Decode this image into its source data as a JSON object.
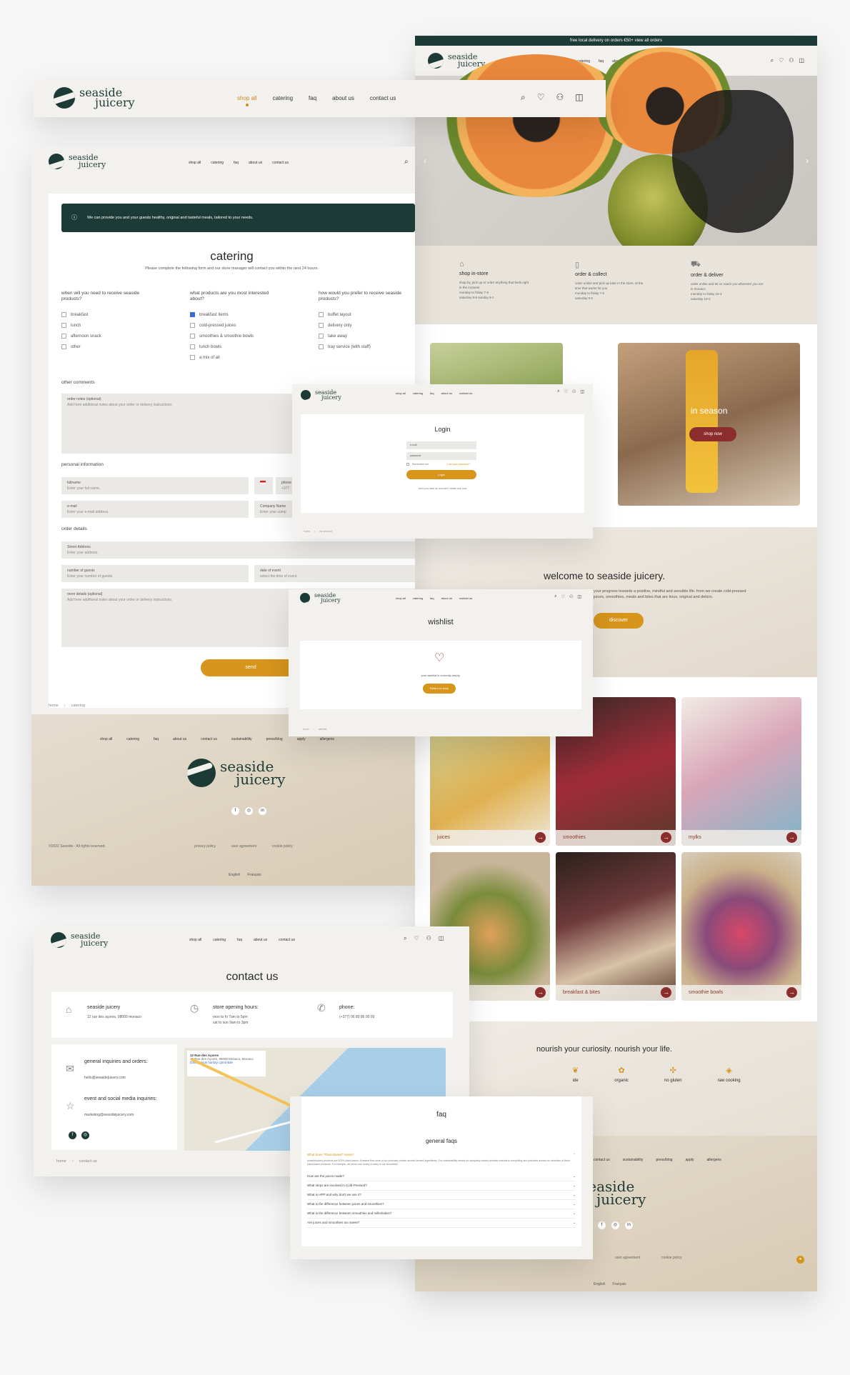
{
  "colors": {
    "brand_green": "#1d3b36",
    "accent_orange": "#d7951b",
    "berry": "#8c2d2d",
    "beige": "#e3d9c8"
  },
  "brand": {
    "line1": "seaside",
    "line2": "juicery"
  },
  "nav": {
    "shop": "shop all",
    "catering": "catering",
    "faq": "faq",
    "about": "about us",
    "contact": "contact us"
  },
  "icons": [
    "search-icon",
    "heart-icon",
    "user-icon",
    "bag-icon"
  ],
  "home": {
    "banner": "free local delivery on orders €50+ view all orders",
    "services": [
      {
        "title": "shop in-store",
        "lines": [
          "shop by, pick up or order anything that feels right",
          "in the moment",
          "monday to friday 7-5",
          "saturday 9-5 sunday 9-1"
        ]
      },
      {
        "title": "order & collect",
        "lines": [
          "order online and pick up later in the store, at the",
          "time that works for you",
          "monday to friday 7-5",
          "saturday 9-5"
        ]
      },
      {
        "title": "order & deliver",
        "lines": [
          "order online and let us reach you wherever you are",
          "in monaco",
          "monday to friday 10-3",
          "saturday 10-2"
        ]
      }
    ],
    "season_title": "in season",
    "season_btn": "shop now",
    "welcome_title": "welcome to seaside juicery.",
    "welcome_text": "your progress towards a positive, mindful and sensible life. from we create cold-pressed juices, smoothies, meals and bites that are tious, original and delicio.",
    "discover": "discover",
    "tiles": [
      "juices",
      "smoothies",
      "mylks",
      "",
      "breakfast & bites",
      "smoothie bowls"
    ],
    "nourish": "nourish your curiosity. nourish your life.",
    "values": [
      "ide",
      "organic",
      "no gluten",
      "raw cooking"
    ],
    "footer_links": [
      "contact us",
      "sustainability",
      "press/blog",
      "apply",
      "allergens"
    ],
    "legal": [
      "user agreement",
      "cookie policy"
    ],
    "langs": [
      "English",
      "Français"
    ]
  },
  "catering": {
    "notice": "We can provide you and your guests healthy, original and tasteful meals, tailored to your needs.",
    "title": "catering",
    "subtitle": "Please complete the following form and our store manager will contact you within the next 24 hours.",
    "q1": "when will you need to receive seaside products?",
    "q1_opts": [
      "breakfast",
      "lunch",
      "afternoon snack",
      "other"
    ],
    "q2": "what products are you most interested about?",
    "q2_opts": [
      "breakfast items",
      "cold-pressed juices",
      "smoothies & smoothie bowls",
      "lunch bowls",
      "a mix of all"
    ],
    "q3": "how would you prefer to receive seaside products?",
    "q3_opts": [
      "buffet layout",
      "delivery only",
      "take away",
      "tray service (with staff)"
    ],
    "other_comments": "other comments",
    "order_notes": "order notes (optional)",
    "order_notes_ph": "Add here additional notes about your order or delivery instructions.",
    "personal": "personal information",
    "fullname": "fullname",
    "fullname_ph": "Enter your full name.",
    "phone": "phone",
    "phone_ph": "+377",
    "email": "e-mail",
    "email_ph": "Enter your e-mail address.",
    "company": "Company Name",
    "company_ph": "Enter your comp",
    "order_details": "order details",
    "street": "Street Address",
    "street_ph": "Enter your address.",
    "guests": "number of guests",
    "guests_ph": "Enter your number of guests.",
    "date": "date of event",
    "date_ph": "select the time of event.",
    "more": "more details (optional)",
    "more_ph": "Add here additional notes about your order or delivery instructions.",
    "send": "send",
    "crumb_home": "home",
    "crumb_cur": "catering"
  },
  "footer": {
    "links": [
      "shop all",
      "catering",
      "faq",
      "about us",
      "contact us",
      "sustainability",
      "press/blog",
      "apply",
      "allergens"
    ],
    "copyright": "©2022 Seaside - All rights reserved.",
    "legal": [
      "privacy policy",
      "user agreement",
      "cookie policy"
    ],
    "langs": [
      "English",
      "Français"
    ]
  },
  "login": {
    "title": "Login",
    "email_ph": "e-mail",
    "pass_ph": "password",
    "remember": "Remember me",
    "forgot": "Lost your password?",
    "btn": "Login",
    "signup": "don't you have an account? create one now",
    "crumb_home": "home",
    "crumb_cur": "my account"
  },
  "wishlist": {
    "title": "wishlist",
    "empty": "your wishlist is currently empty.",
    "btn": "Return to shop",
    "crumb_home": "home",
    "crumb_cur": "wishlist"
  },
  "contact": {
    "title": "contact us",
    "store": "seaside juicery",
    "address": "12 rue des açores, 98000 monaco",
    "hours_title": "store opening hours:",
    "hours1": "mon to fri 7am to 5pm",
    "hours2": "sat to sun 9am to 3pm",
    "phone_title": "phone:",
    "phone": "(+377) 06 80 86 00 00",
    "gen_title": "general inquiries and orders:",
    "gen_email": "hello@seasidejuicery.com",
    "event_title": "event and social media inquiries:",
    "event_email": "marketing@seasidejuicery.com",
    "map_place": "12 Rue des Açores",
    "map_addr": "12 Rue des Açores, 98000 Monaco, Monaco",
    "map_link": "Daha büyük haritayı görüntüle",
    "crumb_home": "home",
    "crumb_cur": "contact us"
  },
  "faq": {
    "title": "faq",
    "section": "general faqs",
    "open_q": "What does \"Plant-Based\" mean?",
    "open_a": "seasidejuicery products are 100% plant-based. It means that none of our products contain animal-derived ingredients. Our sustainability means for sympathy toward animals extends to everything and practices across our selection of fresh plant-based products. For example, we never use honey or dairy in our smoothies.",
    "questions": [
      "How are the juices made?",
      "What steps are involved in Cold-Pressed?",
      "What is HPP and why don't we use it?",
      "What is the difference between juices and smoothies?",
      "What is the difference between smoothies and milkshakes?",
      "Are juices and smoothies too sweet?"
    ]
  }
}
